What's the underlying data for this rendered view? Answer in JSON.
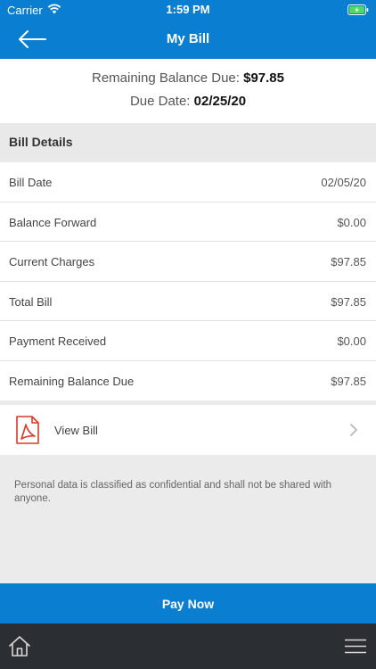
{
  "status_bar": {
    "carrier": "Carrier",
    "time": "1:59 PM"
  },
  "header": {
    "title": "My Bill",
    "back_icon": "arrow-left-icon"
  },
  "summary": {
    "remaining_label": "Remaining Balance Due: ",
    "remaining_value": "$97.85",
    "due_label": "Due Date: ",
    "due_value": "02/25/20"
  },
  "bill_details": {
    "heading": "Bill Details",
    "rows": [
      {
        "label": "Bill Date",
        "value": "02/05/20"
      },
      {
        "label": "Balance Forward",
        "value": "$0.00"
      },
      {
        "label": "Current Charges",
        "value": "$97.85"
      },
      {
        "label": "Total Bill",
        "value": "$97.85"
      },
      {
        "label": "Payment Received",
        "value": "$0.00"
      },
      {
        "label": "Remaining Balance Due",
        "value": "$97.85"
      }
    ]
  },
  "view_bill": {
    "label": "View Bill",
    "icon": "pdf-icon"
  },
  "note": "Personal data is classified as confidential and shall not be shared with anyone.",
  "pay_now": {
    "label": "Pay Now"
  },
  "tab_bar": {
    "home_icon": "home-icon",
    "menu_icon": "hamburger-menu-icon"
  },
  "colors": {
    "brand_blue": "#0a7fd1",
    "tabbar_dark": "#2b2f33",
    "pdf_red": "#d93a2b"
  }
}
